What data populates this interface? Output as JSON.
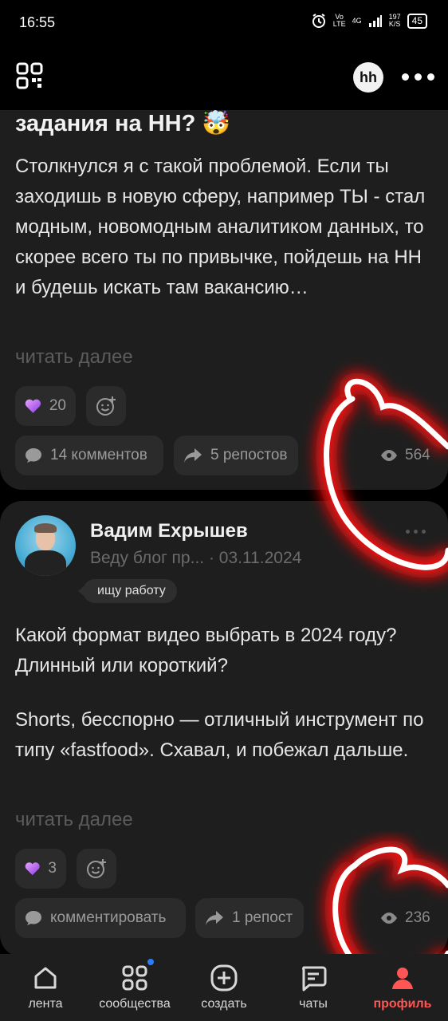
{
  "status_bar": {
    "time": "16:55",
    "network_top": "Vo",
    "network_bottom": "LTE",
    "signal_top": "4G",
    "speed_top": "197",
    "speed_bottom": "K/S",
    "battery": "45"
  },
  "header": {
    "logo": "hh"
  },
  "post1": {
    "title": "задания на НН? 🤯",
    "body": "Столкнулся я с такой проблемой. Если ты заходишь в новую сферу, например ТЫ - стал модным, новомодным аналитиком данных, то скорее всего ты по привычке, пойдешь на НН и будешь искать там вакансию…",
    "read_more": "читать далее",
    "reactions_count": "20",
    "comments_label": "14 комментов",
    "reposts_label": "5 репостов",
    "views": "564"
  },
  "post2": {
    "author_name": "Вадим Ехрышев",
    "author_meta": "Веду блог пр... · 03.11.2024",
    "tag": "ищу работу",
    "title": "Какой формат видео выбрать в 2024 году? Длинный или короткий?",
    "body": "Shorts, бесспорно — отличный инструмент по типу «fastfood». Схавал, и побежал дальше.",
    "read_more": "читать далее",
    "reactions_count": "3",
    "comments_label": "комментировать",
    "reposts_label": "1 репост",
    "views": "236"
  },
  "nav": {
    "items": [
      {
        "label": "лента",
        "icon": "home-icon"
      },
      {
        "label": "сообщества",
        "icon": "grid-icon"
      },
      {
        "label": "создать",
        "icon": "plus-icon"
      },
      {
        "label": "чаты",
        "icon": "chat-icon"
      },
      {
        "label": "профиль",
        "icon": "profile-icon"
      }
    ]
  },
  "colors": {
    "background": "#000000",
    "card": "#1e1e1e",
    "pill": "#2b2b2b",
    "active_nav": "#ff5555",
    "annotation": "#ff1a1a"
  }
}
